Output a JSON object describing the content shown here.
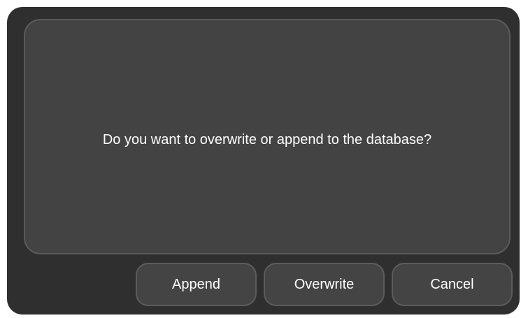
{
  "dialog": {
    "message": "Do you want to overwrite or append to the database?",
    "buttons": {
      "append": "Append",
      "overwrite": "Overwrite",
      "cancel": "Cancel"
    }
  },
  "colors": {
    "dialog_background": "#2f2f2f",
    "panel_background": "#434343",
    "button_background": "#444444",
    "text": "#ffffff"
  }
}
